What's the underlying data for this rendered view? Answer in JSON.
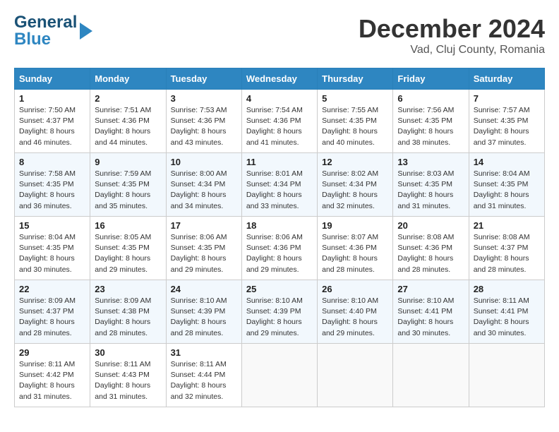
{
  "header": {
    "logo_line1": "General",
    "logo_line2": "Blue",
    "title": "December 2024",
    "subtitle": "Vad, Cluj County, Romania"
  },
  "calendar": {
    "days_of_week": [
      "Sunday",
      "Monday",
      "Tuesday",
      "Wednesday",
      "Thursday",
      "Friday",
      "Saturday"
    ],
    "weeks": [
      [
        {
          "day": 1,
          "sunrise": "7:50 AM",
          "sunset": "4:37 PM",
          "daylight": "8 hours and 46 minutes."
        },
        {
          "day": 2,
          "sunrise": "7:51 AM",
          "sunset": "4:36 PM",
          "daylight": "8 hours and 44 minutes."
        },
        {
          "day": 3,
          "sunrise": "7:53 AM",
          "sunset": "4:36 PM",
          "daylight": "8 hours and 43 minutes."
        },
        {
          "day": 4,
          "sunrise": "7:54 AM",
          "sunset": "4:36 PM",
          "daylight": "8 hours and 41 minutes."
        },
        {
          "day": 5,
          "sunrise": "7:55 AM",
          "sunset": "4:35 PM",
          "daylight": "8 hours and 40 minutes."
        },
        {
          "day": 6,
          "sunrise": "7:56 AM",
          "sunset": "4:35 PM",
          "daylight": "8 hours and 38 minutes."
        },
        {
          "day": 7,
          "sunrise": "7:57 AM",
          "sunset": "4:35 PM",
          "daylight": "8 hours and 37 minutes."
        }
      ],
      [
        {
          "day": 8,
          "sunrise": "7:58 AM",
          "sunset": "4:35 PM",
          "daylight": "8 hours and 36 minutes."
        },
        {
          "day": 9,
          "sunrise": "7:59 AM",
          "sunset": "4:35 PM",
          "daylight": "8 hours and 35 minutes."
        },
        {
          "day": 10,
          "sunrise": "8:00 AM",
          "sunset": "4:34 PM",
          "daylight": "8 hours and 34 minutes."
        },
        {
          "day": 11,
          "sunrise": "8:01 AM",
          "sunset": "4:34 PM",
          "daylight": "8 hours and 33 minutes."
        },
        {
          "day": 12,
          "sunrise": "8:02 AM",
          "sunset": "4:34 PM",
          "daylight": "8 hours and 32 minutes."
        },
        {
          "day": 13,
          "sunrise": "8:03 AM",
          "sunset": "4:35 PM",
          "daylight": "8 hours and 31 minutes."
        },
        {
          "day": 14,
          "sunrise": "8:04 AM",
          "sunset": "4:35 PM",
          "daylight": "8 hours and 31 minutes."
        }
      ],
      [
        {
          "day": 15,
          "sunrise": "8:04 AM",
          "sunset": "4:35 PM",
          "daylight": "8 hours and 30 minutes."
        },
        {
          "day": 16,
          "sunrise": "8:05 AM",
          "sunset": "4:35 PM",
          "daylight": "8 hours and 29 minutes."
        },
        {
          "day": 17,
          "sunrise": "8:06 AM",
          "sunset": "4:35 PM",
          "daylight": "8 hours and 29 minutes."
        },
        {
          "day": 18,
          "sunrise": "8:06 AM",
          "sunset": "4:36 PM",
          "daylight": "8 hours and 29 minutes."
        },
        {
          "day": 19,
          "sunrise": "8:07 AM",
          "sunset": "4:36 PM",
          "daylight": "8 hours and 28 minutes."
        },
        {
          "day": 20,
          "sunrise": "8:08 AM",
          "sunset": "4:36 PM",
          "daylight": "8 hours and 28 minutes."
        },
        {
          "day": 21,
          "sunrise": "8:08 AM",
          "sunset": "4:37 PM",
          "daylight": "8 hours and 28 minutes."
        }
      ],
      [
        {
          "day": 22,
          "sunrise": "8:09 AM",
          "sunset": "4:37 PM",
          "daylight": "8 hours and 28 minutes."
        },
        {
          "day": 23,
          "sunrise": "8:09 AM",
          "sunset": "4:38 PM",
          "daylight": "8 hours and 28 minutes."
        },
        {
          "day": 24,
          "sunrise": "8:10 AM",
          "sunset": "4:39 PM",
          "daylight": "8 hours and 28 minutes."
        },
        {
          "day": 25,
          "sunrise": "8:10 AM",
          "sunset": "4:39 PM",
          "daylight": "8 hours and 29 minutes."
        },
        {
          "day": 26,
          "sunrise": "8:10 AM",
          "sunset": "4:40 PM",
          "daylight": "8 hours and 29 minutes."
        },
        {
          "day": 27,
          "sunrise": "8:10 AM",
          "sunset": "4:41 PM",
          "daylight": "8 hours and 30 minutes."
        },
        {
          "day": 28,
          "sunrise": "8:11 AM",
          "sunset": "4:41 PM",
          "daylight": "8 hours and 30 minutes."
        }
      ],
      [
        {
          "day": 29,
          "sunrise": "8:11 AM",
          "sunset": "4:42 PM",
          "daylight": "8 hours and 31 minutes."
        },
        {
          "day": 30,
          "sunrise": "8:11 AM",
          "sunset": "4:43 PM",
          "daylight": "8 hours and 31 minutes."
        },
        {
          "day": 31,
          "sunrise": "8:11 AM",
          "sunset": "4:44 PM",
          "daylight": "8 hours and 32 minutes."
        },
        null,
        null,
        null,
        null
      ]
    ],
    "sunrise_label": "Sunrise:",
    "sunset_label": "Sunset:",
    "daylight_label": "Daylight:"
  }
}
